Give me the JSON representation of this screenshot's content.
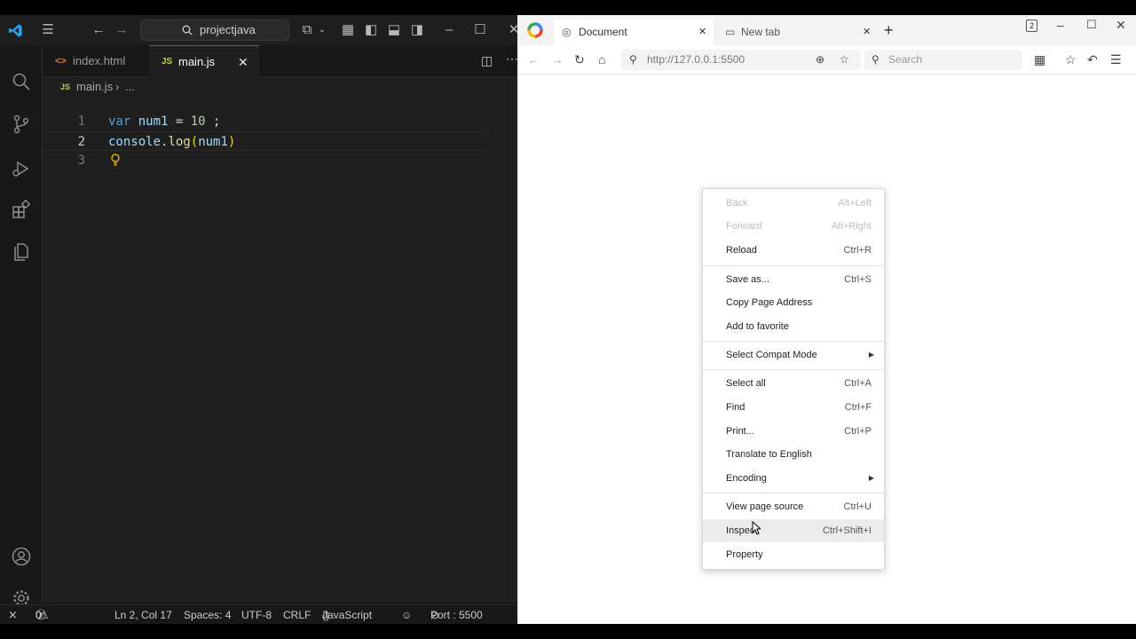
{
  "vscode": {
    "search_text": "projectjava",
    "tabs": [
      {
        "label": "index.html",
        "icon": "<>"
      },
      {
        "label": "main.js",
        "icon": "JS"
      }
    ],
    "breadcrumb": {
      "icon": "JS",
      "file": "main.js",
      "rest": "..."
    },
    "line_numbers": [
      "1",
      "2",
      "3"
    ],
    "code": {
      "l1": {
        "kw": "var",
        "id": "num1",
        "eq": " = ",
        "num": "10",
        "end": " ;"
      },
      "l2": {
        "obj": "console",
        "dot": ".",
        "fn": "log",
        "open": "(",
        "arg": "num1",
        "close": ")"
      }
    },
    "status": {
      "errors": "0",
      "warnings": "0",
      "position": "Ln 2, Col 17",
      "spaces": "Spaces: 4",
      "encoding": "UTF-8",
      "eol": "CRLF",
      "language": "JavaScript",
      "port": "Port : 5500"
    }
  },
  "browser": {
    "tabs": [
      {
        "label": "Document"
      },
      {
        "label": "New tab"
      }
    ],
    "tab_count": "2",
    "address": "http://127.0.0.1:5500",
    "search_placeholder": "Search",
    "menu": {
      "back": {
        "label": "Back",
        "shortcut": "Alt+Left"
      },
      "forward": {
        "label": "Forward",
        "shortcut": "Alt+Right"
      },
      "reload": {
        "label": "Reload",
        "shortcut": "Ctrl+R"
      },
      "save_as": {
        "label": "Save as...",
        "shortcut": "Ctrl+S"
      },
      "copy_address": {
        "label": "Copy Page Address"
      },
      "add_favorite": {
        "label": "Add to favorite"
      },
      "compat_mode": {
        "label": "Select Compat Mode"
      },
      "select_all": {
        "label": "Select all",
        "shortcut": "Ctrl+A"
      },
      "find": {
        "label": "Find",
        "shortcut": "Ctrl+F"
      },
      "print": {
        "label": "Print...",
        "shortcut": "Ctrl+P"
      },
      "translate": {
        "label": "Translate to English"
      },
      "encoding": {
        "label": "Encoding"
      },
      "view_source": {
        "label": "View page source",
        "shortcut": "Ctrl+U"
      },
      "inspect": {
        "label": "Inspect",
        "shortcut": "Ctrl+Shift+I"
      },
      "property": {
        "label": "Property"
      }
    }
  },
  "colors": {
    "vscode_accent": "#0078d4",
    "vscode_bg": "#1f1f1f",
    "menu_highlight": "#ececec"
  }
}
